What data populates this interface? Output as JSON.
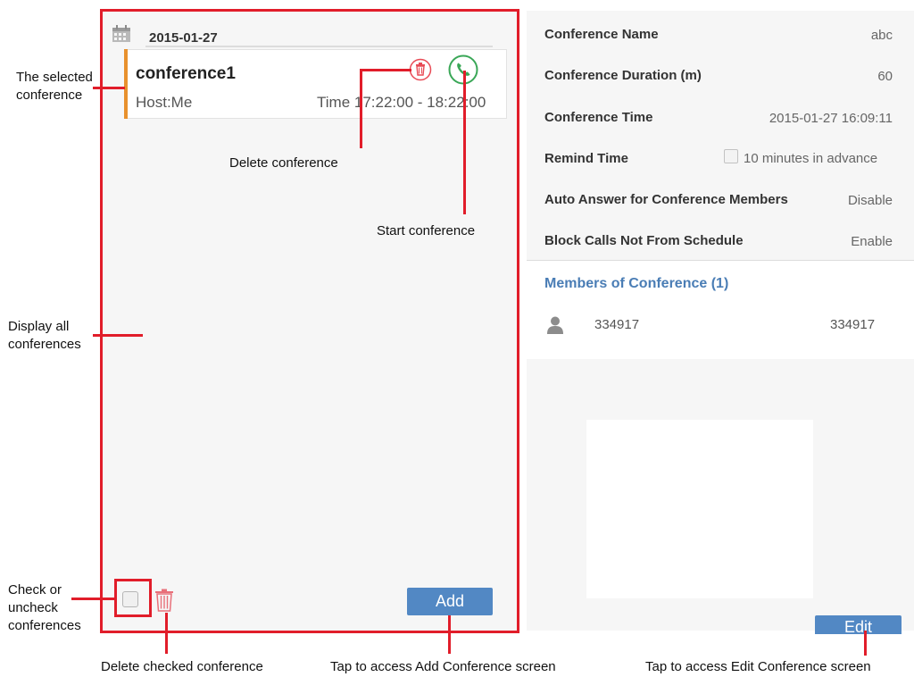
{
  "conference_list": {
    "date": "2015-01-27",
    "conference": {
      "name": "conference1",
      "host": "Host:Me",
      "time": "Time 17:22:00 - 18:22:00"
    },
    "add_label": "Add"
  },
  "details": {
    "rows": [
      {
        "label": "Conference Name",
        "value": "abc"
      },
      {
        "label": "Conference Duration (m)",
        "value": "60"
      },
      {
        "label": "Conference Time",
        "value": "2015-01-27 16:09:11"
      },
      {
        "label": "Remind Time",
        "value": "10 minutes in advance"
      },
      {
        "label": "Auto Answer for Conference Members",
        "value": "Disable"
      },
      {
        "label": "Block Calls Not From Schedule",
        "value": "Enable"
      }
    ],
    "members_title": "Members of Conference (1)",
    "members": [
      {
        "number": "334917",
        "name": "334917"
      }
    ],
    "edit_label": "Edit"
  },
  "annotations": {
    "selected_conference": "The selected conference",
    "display_all": "Display all conferences",
    "check_uncheck": "Check or uncheck conferences",
    "delete_conference": "Delete conference",
    "start_conference": "Start conference",
    "delete_checked": "Delete checked conference",
    "tap_add": "Tap to access Add Conference screen",
    "tap_edit": "Tap to access Edit Conference screen"
  },
  "colors": {
    "annotation_red": "#e11d2a",
    "selected_accent": "#e8912d",
    "button_blue": "#5288c4",
    "start_green": "#3aa757",
    "members_title_blue": "#4a7db5"
  },
  "icons": [
    "calendar-icon",
    "delete-icon",
    "phone-icon",
    "trash-icon",
    "person-icon"
  ]
}
